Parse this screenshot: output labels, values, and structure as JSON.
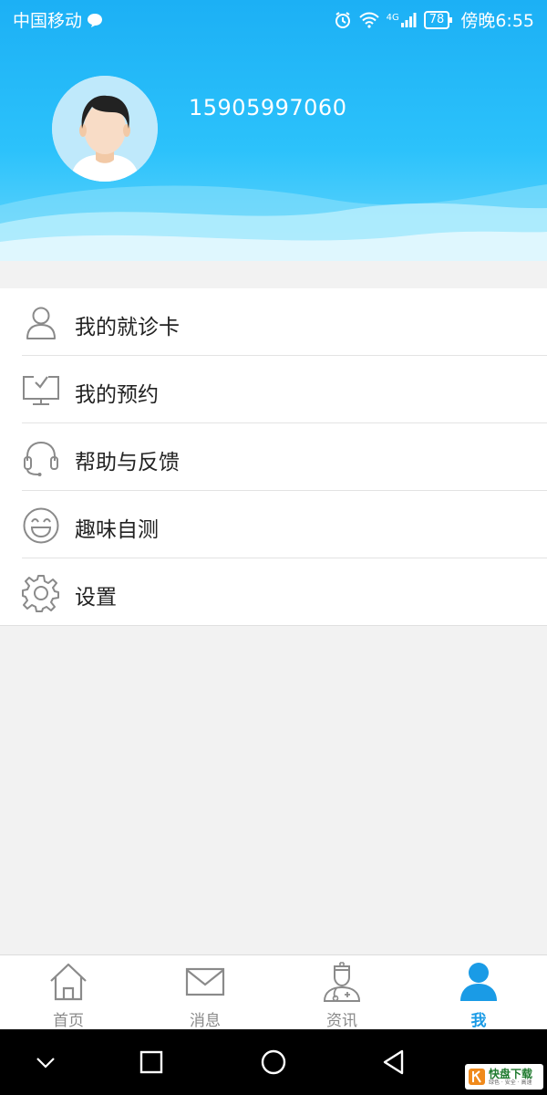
{
  "status_bar": {
    "carrier": "中国移动",
    "network": "4G",
    "battery": "78",
    "time": "傍晚6:55"
  },
  "profile": {
    "phone": "15905997060"
  },
  "menu": {
    "items": [
      {
        "label": "我的就诊卡",
        "icon": "person-card-icon"
      },
      {
        "label": "我的预约",
        "icon": "monitor-check-icon"
      },
      {
        "label": "帮助与反馈",
        "icon": "headset-icon"
      },
      {
        "label": "趣味自测",
        "icon": "smiley-icon"
      },
      {
        "label": "设置",
        "icon": "gear-icon"
      }
    ]
  },
  "tabbar": {
    "tabs": [
      {
        "label": "首页",
        "icon": "home-icon"
      },
      {
        "label": "消息",
        "icon": "mail-icon"
      },
      {
        "label": "资讯",
        "icon": "doctor-icon"
      },
      {
        "label": "我",
        "icon": "user-icon",
        "active": true
      }
    ]
  },
  "watermark": {
    "brand": "快盘下载",
    "tagline": "绿色 · 安全 · 高速"
  },
  "colors": {
    "header_top": "#1cb0f5",
    "header_bottom": "#6fd9fb",
    "accent": "#1a9be6",
    "icon_gray": "#8a8a8a"
  }
}
